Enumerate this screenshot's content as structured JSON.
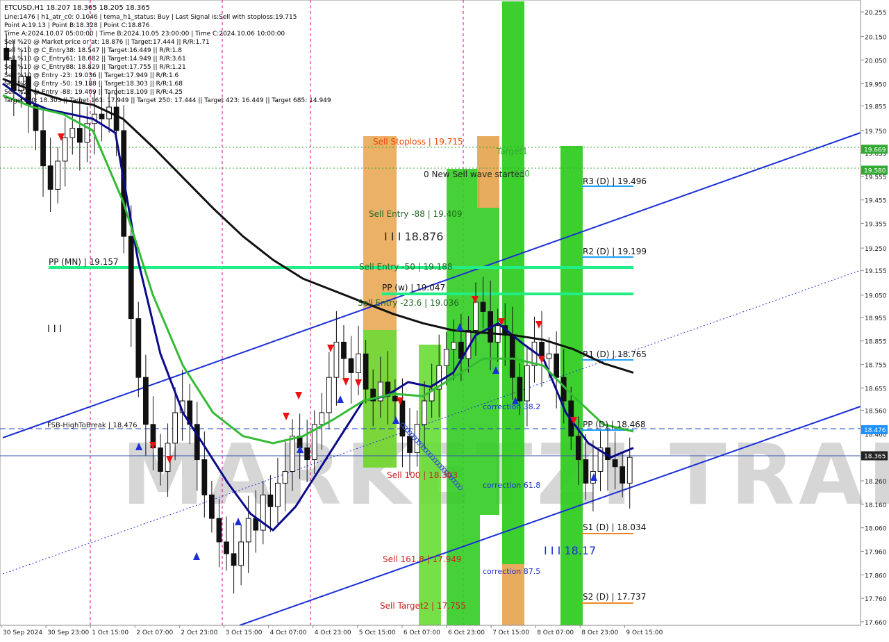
{
  "window": {
    "symbol_title": "ETCUSD,H1  18.207 18.365 18.205 18.365"
  },
  "info_panel": {
    "lines": [
      "Line:1476 | h1_atr_c0: 0.1046 | tema_h1_status: Buy | Last Signal is:Sell with stoploss:19.715",
      "Point A:19.13 | Point B:18.328 | Point C:18.876",
      "Time A:2024.10.07 05:00:00 | Time B:2024.10.05 23:00:00 | Time C:2024.10.06 10:00:00",
      "Sell %20 @ Market price or at: 18.876 || Target:17.444 || R/R:1.71",
      "Sell %10 @ C_Entry38: 18.547 || Target:16.449 || R/R:1.8",
      "Sell %10 @ C_Entry61: 18.682 || Target:14.949 || R/R:3.61",
      "Sell %10 @ C_Entry88: 18.829 || Target:17.755 || R/R:1.21",
      "Sell %10 @ Entry -23: 19.036 || Target:17.949 || R/R:1.6",
      "Sell %20 @ Entry -50: 19.188 || Target:18.303 || R/R:1.68",
      "Sell %20 @ Entry -88: 19.409 || Target:18.109 || R/R:4.25",
      "Target100: 18.303 || Target 161: 17.949 || Target 250: 17.444 || Target 423: 16.449 || Target 685: 14.949"
    ]
  },
  "watermark": "MARKETZI TRADE",
  "chart_data": {
    "type": "candlestick",
    "symbol": "ETCUSD",
    "timeframe": "H1",
    "ohlc_last": {
      "open": 18.207,
      "high": 18.365,
      "low": 18.205,
      "close": 18.365
    },
    "ylim": [
      17.66,
      20.27
    ],
    "y_ticks": [
      "20.255",
      "20.150",
      "20.050",
      "19.950",
      "19.855",
      "19.750",
      "19.655",
      "19.555",
      "19.455",
      "19.355",
      "19.250",
      "19.155",
      "19.050",
      "18.955",
      "18.855",
      "18.755",
      "18.655",
      "18.560",
      "18.460",
      "18.360",
      "18.260",
      "18.160",
      "18.060",
      "17.960",
      "17.860",
      "17.760",
      "17.660"
    ],
    "x_ticks": [
      "30 Sep 2024",
      "30 Sep 23:00",
      "1 Oct 15:00",
      "2 Oct 07:00",
      "2 Oct 23:00",
      "3 Oct 15:00",
      "4 Oct 07:00",
      "4 Oct 23:00",
      "5 Oct 15:00",
      "6 Oct 07:00",
      "6 Oct 23:00",
      "7 Oct 15:00",
      "8 Oct 07:00",
      "8 Oct 23:00",
      "9 Oct 15:00"
    ],
    "price_tags": [
      {
        "value": 19.669,
        "label": "19.669",
        "color": "#33aa33"
      },
      {
        "value": 19.58,
        "label": "19.580",
        "color": "#33aa33"
      },
      {
        "value": 18.476,
        "label": "18.476",
        "color": "#1e90ff"
      },
      {
        "value": 18.365,
        "label": "18.365",
        "color": "#222222"
      }
    ],
    "levels": [
      {
        "label": "R3 (D) | 19.496",
        "value": 19.496
      },
      {
        "label": "R2 (D) | 19.199",
        "value": 19.199
      },
      {
        "label": "R1 (D) | 18.765",
        "value": 18.765
      },
      {
        "label": "PP (D) | 18.468",
        "value": 18.468
      },
      {
        "label": "S1 (D) | 18.034",
        "value": 18.034
      },
      {
        "label": "S2 (D) | 17.737",
        "value": 17.737
      },
      {
        "label": "PP (MN) | 19.157",
        "value": 19.157
      },
      {
        "label": "PP (w) | 19.047",
        "value": 19.047
      },
      {
        "label": "FSB-HighToBreak | 18.476",
        "value": 18.476
      }
    ],
    "annotations": {
      "sell_stoploss": "Sell Stoploss | 19.715",
      "target1": "Target1",
      "new_wave": "0 New Sell wave started",
      "hundred": "100",
      "sell_entry_88": "Sell Entry -88 | 19.409",
      "big_c": "I I I 18.876",
      "sell_entry_50": "Sell Entry -50 | 19.188",
      "sell_entry_23": "Sell Entry -23.6 | 19.036",
      "sell_100": "Sell 100 | 18.303",
      "sell_161": "Sell 161.8 | 17.949",
      "sell_target2": "Sell Target2 | 17.755",
      "corr_382": "correction 38.2",
      "corr_618": "correction 61.8",
      "corr_875": "correction 87.5",
      "big_b": "I I I 18.17",
      "triple": "I I I"
    },
    "close_series": [
      20.05,
      19.92,
      19.98,
      19.86,
      19.75,
      19.6,
      19.5,
      19.62,
      19.72,
      19.76,
      19.7,
      19.78,
      19.82,
      19.8,
      19.85,
      19.75,
      19.3,
      18.95,
      18.7,
      18.5,
      18.4,
      18.3,
      18.42,
      18.55,
      18.6,
      18.5,
      18.35,
      18.2,
      18.1,
      18.0,
      17.95,
      17.9,
      18.0,
      18.1,
      18.05,
      18.2,
      18.15,
      18.25,
      18.3,
      18.45,
      18.4,
      18.35,
      18.5,
      18.55,
      18.7,
      18.85,
      18.78,
      18.72,
      18.8,
      18.65,
      18.6,
      18.68,
      18.62,
      18.6,
      18.45,
      18.38,
      18.5,
      18.6,
      18.65,
      18.75,
      18.82,
      18.85,
      18.78,
      18.9,
      19.02,
      18.98,
      18.85,
      18.92,
      18.88,
      18.7,
      18.6,
      18.75,
      18.85,
      18.78,
      18.8,
      18.7,
      18.6,
      18.45,
      18.35,
      18.25,
      18.3,
      18.4,
      18.35,
      18.32,
      18.25,
      18.36
    ],
    "series": [
      {
        "name": "EMA fast",
        "color": "#0a0a8a",
        "values": [
          19.95,
          19.88,
          19.84,
          19.82,
          19.8,
          19.74,
          19.2,
          18.8,
          18.55,
          18.4,
          18.25,
          18.12,
          18.05,
          18.15,
          18.3,
          18.45,
          18.6,
          18.62,
          18.68,
          18.66,
          18.72,
          18.88,
          18.93,
          18.85,
          18.78,
          18.55,
          18.42,
          18.36,
          18.4
        ]
      },
      {
        "name": "EMA mid",
        "color": "#33bb33",
        "values": [
          19.9,
          19.85,
          19.82,
          19.75,
          19.45,
          19.05,
          18.75,
          18.55,
          18.45,
          18.42,
          18.45,
          18.52,
          18.6,
          18.63,
          18.62,
          18.7,
          18.78,
          18.78,
          18.75,
          18.62,
          18.5,
          18.47
        ]
      },
      {
        "name": "EMA slow",
        "color": "#111111",
        "values": [
          19.97,
          19.92,
          19.88,
          19.86,
          19.8,
          19.68,
          19.55,
          19.42,
          19.3,
          19.2,
          19.12,
          19.07,
          19.02,
          18.97,
          18.93,
          18.9,
          18.89,
          18.88,
          18.86,
          18.82,
          18.76,
          18.72
        ]
      }
    ]
  }
}
